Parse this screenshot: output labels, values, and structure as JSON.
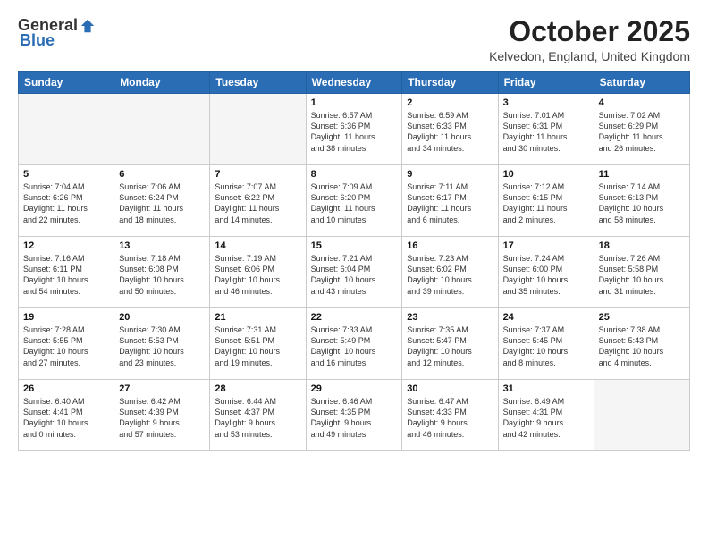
{
  "header": {
    "logo_general": "General",
    "logo_blue": "Blue",
    "month_title": "October 2025",
    "location": "Kelvedon, England, United Kingdom"
  },
  "weekdays": [
    "Sunday",
    "Monday",
    "Tuesday",
    "Wednesday",
    "Thursday",
    "Friday",
    "Saturday"
  ],
  "weeks": [
    [
      {
        "day": "",
        "info": ""
      },
      {
        "day": "",
        "info": ""
      },
      {
        "day": "",
        "info": ""
      },
      {
        "day": "1",
        "info": "Sunrise: 6:57 AM\nSunset: 6:36 PM\nDaylight: 11 hours\nand 38 minutes."
      },
      {
        "day": "2",
        "info": "Sunrise: 6:59 AM\nSunset: 6:33 PM\nDaylight: 11 hours\nand 34 minutes."
      },
      {
        "day": "3",
        "info": "Sunrise: 7:01 AM\nSunset: 6:31 PM\nDaylight: 11 hours\nand 30 minutes."
      },
      {
        "day": "4",
        "info": "Sunrise: 7:02 AM\nSunset: 6:29 PM\nDaylight: 11 hours\nand 26 minutes."
      }
    ],
    [
      {
        "day": "5",
        "info": "Sunrise: 7:04 AM\nSunset: 6:26 PM\nDaylight: 11 hours\nand 22 minutes."
      },
      {
        "day": "6",
        "info": "Sunrise: 7:06 AM\nSunset: 6:24 PM\nDaylight: 11 hours\nand 18 minutes."
      },
      {
        "day": "7",
        "info": "Sunrise: 7:07 AM\nSunset: 6:22 PM\nDaylight: 11 hours\nand 14 minutes."
      },
      {
        "day": "8",
        "info": "Sunrise: 7:09 AM\nSunset: 6:20 PM\nDaylight: 11 hours\nand 10 minutes."
      },
      {
        "day": "9",
        "info": "Sunrise: 7:11 AM\nSunset: 6:17 PM\nDaylight: 11 hours\nand 6 minutes."
      },
      {
        "day": "10",
        "info": "Sunrise: 7:12 AM\nSunset: 6:15 PM\nDaylight: 11 hours\nand 2 minutes."
      },
      {
        "day": "11",
        "info": "Sunrise: 7:14 AM\nSunset: 6:13 PM\nDaylight: 10 hours\nand 58 minutes."
      }
    ],
    [
      {
        "day": "12",
        "info": "Sunrise: 7:16 AM\nSunset: 6:11 PM\nDaylight: 10 hours\nand 54 minutes."
      },
      {
        "day": "13",
        "info": "Sunrise: 7:18 AM\nSunset: 6:08 PM\nDaylight: 10 hours\nand 50 minutes."
      },
      {
        "day": "14",
        "info": "Sunrise: 7:19 AM\nSunset: 6:06 PM\nDaylight: 10 hours\nand 46 minutes."
      },
      {
        "day": "15",
        "info": "Sunrise: 7:21 AM\nSunset: 6:04 PM\nDaylight: 10 hours\nand 43 minutes."
      },
      {
        "day": "16",
        "info": "Sunrise: 7:23 AM\nSunset: 6:02 PM\nDaylight: 10 hours\nand 39 minutes."
      },
      {
        "day": "17",
        "info": "Sunrise: 7:24 AM\nSunset: 6:00 PM\nDaylight: 10 hours\nand 35 minutes."
      },
      {
        "day": "18",
        "info": "Sunrise: 7:26 AM\nSunset: 5:58 PM\nDaylight: 10 hours\nand 31 minutes."
      }
    ],
    [
      {
        "day": "19",
        "info": "Sunrise: 7:28 AM\nSunset: 5:55 PM\nDaylight: 10 hours\nand 27 minutes."
      },
      {
        "day": "20",
        "info": "Sunrise: 7:30 AM\nSunset: 5:53 PM\nDaylight: 10 hours\nand 23 minutes."
      },
      {
        "day": "21",
        "info": "Sunrise: 7:31 AM\nSunset: 5:51 PM\nDaylight: 10 hours\nand 19 minutes."
      },
      {
        "day": "22",
        "info": "Sunrise: 7:33 AM\nSunset: 5:49 PM\nDaylight: 10 hours\nand 16 minutes."
      },
      {
        "day": "23",
        "info": "Sunrise: 7:35 AM\nSunset: 5:47 PM\nDaylight: 10 hours\nand 12 minutes."
      },
      {
        "day": "24",
        "info": "Sunrise: 7:37 AM\nSunset: 5:45 PM\nDaylight: 10 hours\nand 8 minutes."
      },
      {
        "day": "25",
        "info": "Sunrise: 7:38 AM\nSunset: 5:43 PM\nDaylight: 10 hours\nand 4 minutes."
      }
    ],
    [
      {
        "day": "26",
        "info": "Sunrise: 6:40 AM\nSunset: 4:41 PM\nDaylight: 10 hours\nand 0 minutes."
      },
      {
        "day": "27",
        "info": "Sunrise: 6:42 AM\nSunset: 4:39 PM\nDaylight: 9 hours\nand 57 minutes."
      },
      {
        "day": "28",
        "info": "Sunrise: 6:44 AM\nSunset: 4:37 PM\nDaylight: 9 hours\nand 53 minutes."
      },
      {
        "day": "29",
        "info": "Sunrise: 6:46 AM\nSunset: 4:35 PM\nDaylight: 9 hours\nand 49 minutes."
      },
      {
        "day": "30",
        "info": "Sunrise: 6:47 AM\nSunset: 4:33 PM\nDaylight: 9 hours\nand 46 minutes."
      },
      {
        "day": "31",
        "info": "Sunrise: 6:49 AM\nSunset: 4:31 PM\nDaylight: 9 hours\nand 42 minutes."
      },
      {
        "day": "",
        "info": ""
      }
    ]
  ]
}
